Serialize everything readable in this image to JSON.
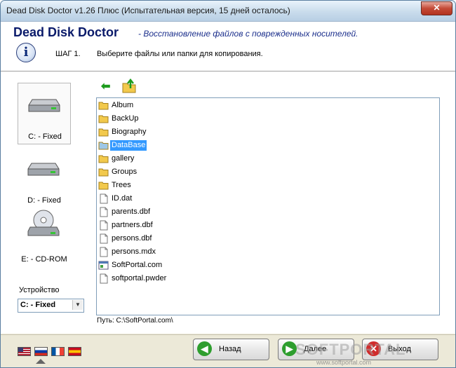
{
  "window": {
    "title": "Dead Disk Doctor v1.26 Плюс (Испытательная версия, 15 дней осталось)",
    "close_glyph": "✕"
  },
  "header": {
    "app_name": "Dead Disk Doctor",
    "app_subtitle": "- Восстановление файлов с поврежденных носителей.",
    "info_glyph": "i",
    "step_label": "ШАГ 1.",
    "step_text": "Выберите файлы или папки для копирования."
  },
  "drives": [
    {
      "label": "C: - Fixed",
      "icon": "hard-drive-icon",
      "selected": true
    },
    {
      "label": "D: - Fixed",
      "icon": "hard-drive-icon",
      "selected": false
    },
    {
      "label": "E: - CD-ROM",
      "icon": "cdrom-drive-icon",
      "selected": false
    }
  ],
  "device": {
    "label": "Устройство",
    "value": "C: - Fixed"
  },
  "toolbar": {
    "back_icon": "green-back-arrow-icon",
    "up_icon": "folder-up-icon",
    "back_glyph": "⬅"
  },
  "files": [
    {
      "name": "Album",
      "type": "folder",
      "selected": false
    },
    {
      "name": "BackUp",
      "type": "folder",
      "selected": false
    },
    {
      "name": "Biography",
      "type": "folder",
      "selected": false
    },
    {
      "name": "DataBase",
      "type": "folder",
      "selected": true
    },
    {
      "name": "gallery",
      "type": "folder",
      "selected": false
    },
    {
      "name": "Groups",
      "type": "folder",
      "selected": false
    },
    {
      "name": "Trees",
      "type": "folder",
      "selected": false
    },
    {
      "name": "ID.dat",
      "type": "file",
      "selected": false
    },
    {
      "name": "parents.dbf",
      "type": "file",
      "selected": false
    },
    {
      "name": "partners.dbf",
      "type": "file",
      "selected": false
    },
    {
      "name": "persons.dbf",
      "type": "file",
      "selected": false
    },
    {
      "name": "persons.mdx",
      "type": "file",
      "selected": false
    },
    {
      "name": "SoftPortal.com",
      "type": "web-shortcut",
      "selected": false
    },
    {
      "name": "softportal.pwder",
      "type": "file",
      "selected": false
    }
  ],
  "path": "Путь: C:\\SoftPortal.com\\",
  "languages": [
    {
      "icon": "us-flag-icon",
      "colors": [
        "#3c3b6e",
        "#b22234",
        "#ffffff"
      ]
    },
    {
      "icon": "ru-flag-icon",
      "colors": [
        "#ffffff",
        "#0039a6",
        "#d52b1e"
      ]
    },
    {
      "icon": "fr-flag-icon",
      "colors": [
        "#0055a4",
        "#ffffff",
        "#ef4135"
      ]
    },
    {
      "icon": "es-flag-icon",
      "colors": [
        "#c60b1e",
        "#ffc400",
        "#c60b1e"
      ]
    }
  ],
  "buttons": {
    "back": {
      "label": "Назад",
      "glyph": "◀",
      "color": "#2e9e2e"
    },
    "next": {
      "label": "Далее",
      "glyph": "▶",
      "color": "#2e9e2e"
    },
    "exit": {
      "label": "Выход",
      "glyph": "✕",
      "color": "#d02c2c"
    }
  },
  "watermark": {
    "text": "SOFTPORTAL",
    "sub": "www.softportal.com"
  }
}
